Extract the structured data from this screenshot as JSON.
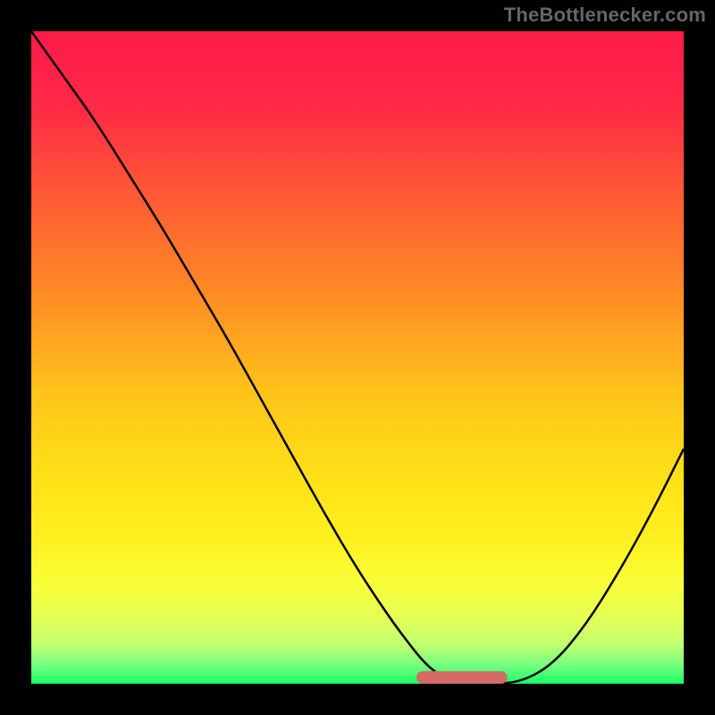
{
  "attribution": "TheBottlenecker.com",
  "chart_data": {
    "type": "line",
    "title": "",
    "xlabel": "",
    "ylabel": "",
    "xlim": [
      0,
      100
    ],
    "ylim": [
      0,
      100
    ],
    "series": [
      {
        "name": "curve",
        "x": [
          0,
          5,
          10,
          15,
          20,
          25,
          30,
          35,
          40,
          45,
          50,
          55,
          58,
          60,
          62,
          64,
          66,
          68,
          70,
          75,
          80,
          85,
          90,
          95,
          100
        ],
        "y": [
          100,
          93,
          86,
          78,
          70,
          61.5,
          53,
          44,
          35,
          26,
          17.5,
          10,
          6,
          3.5,
          1.7,
          0.7,
          0.2,
          0,
          0,
          0.2,
          3,
          9,
          17,
          26,
          36
        ]
      },
      {
        "name": "bottleneck-bar",
        "x": [
          60,
          72
        ],
        "y": [
          0,
          0
        ],
        "style": "thick"
      }
    ],
    "background": {
      "type": "vertical-gradient",
      "stops": [
        {
          "pos": 0.0,
          "color": "#ff1a4a"
        },
        {
          "pos": 0.12,
          "color": "#ff2a45"
        },
        {
          "pos": 0.25,
          "color": "#ff5a35"
        },
        {
          "pos": 0.4,
          "color": "#ff8a25"
        },
        {
          "pos": 0.55,
          "color": "#ffc21a"
        },
        {
          "pos": 0.68,
          "color": "#ffe018"
        },
        {
          "pos": 0.78,
          "color": "#fff020"
        },
        {
          "pos": 0.85,
          "color": "#f8ff3a"
        },
        {
          "pos": 0.9,
          "color": "#e4ff55"
        },
        {
          "pos": 0.94,
          "color": "#c0ff70"
        },
        {
          "pos": 0.97,
          "color": "#7aff80"
        },
        {
          "pos": 1.0,
          "color": "#1aff6a"
        }
      ]
    },
    "curve_color": "#000000",
    "bar_color": "#d66a66"
  }
}
